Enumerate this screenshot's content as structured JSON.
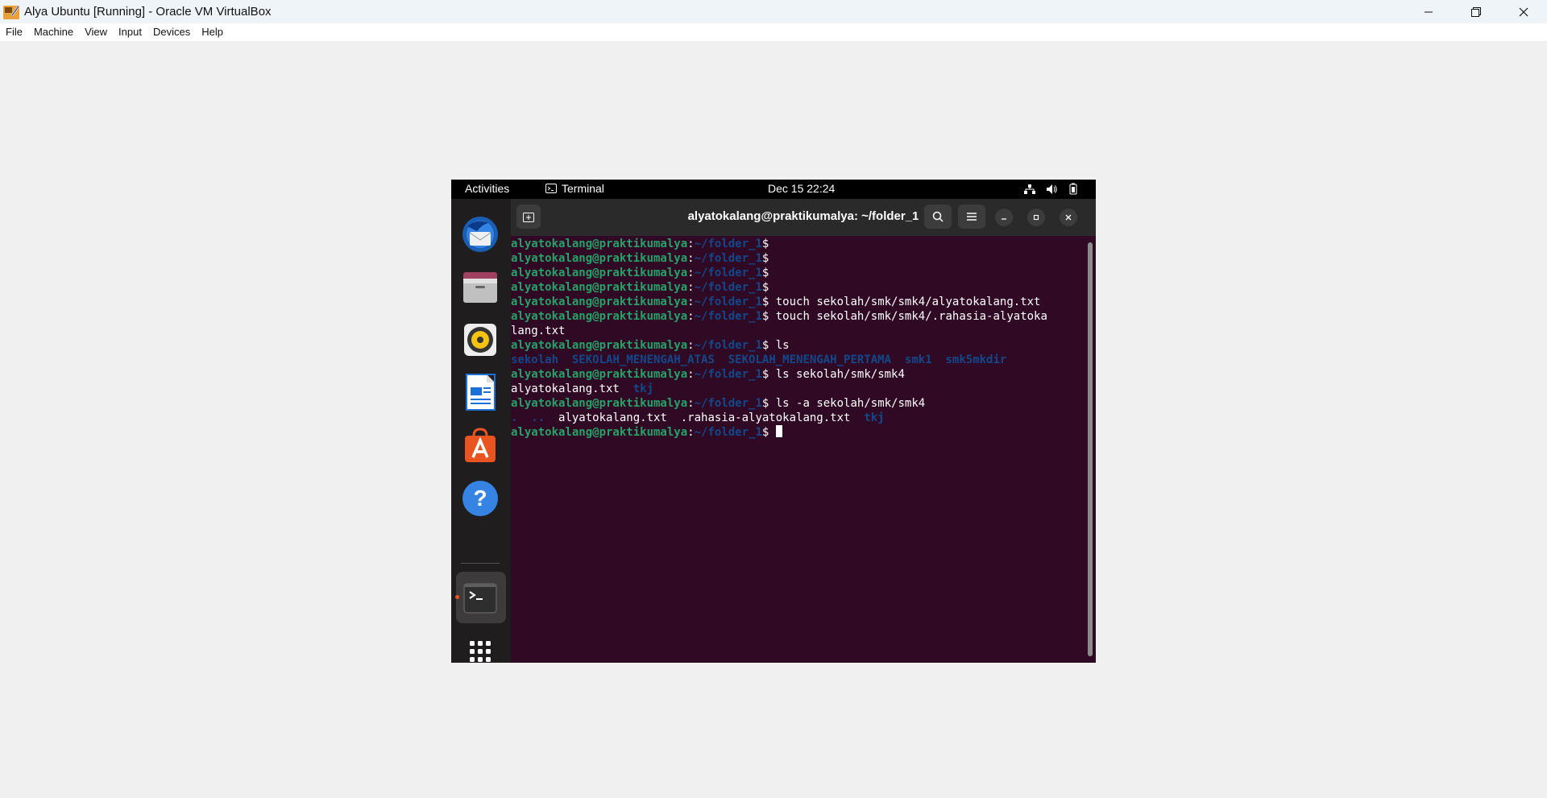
{
  "host": {
    "window_title": "Alya Ubuntu [Running] - Oracle VM VirtualBox",
    "menu": [
      "File",
      "Machine",
      "View",
      "Input",
      "Devices",
      "Help"
    ]
  },
  "guest": {
    "topbar": {
      "activities": "Activities",
      "app_name": "Terminal",
      "clock": "Dec 15  22:24"
    },
    "dock": [
      "thunderbird-mail",
      "files",
      "rhythmbox",
      "libreoffice-writer",
      "ubuntu-software",
      "help",
      "terminal",
      "show-apps"
    ],
    "terminal": {
      "title": "alyatokalang@praktikumalya: ~/folder_1",
      "prompt_user": "alyatokalang@praktikumalya",
      "prompt_path": "~/folder_1",
      "lines": [
        {
          "type": "prompt",
          "cmd": ""
        },
        {
          "type": "prompt",
          "cmd": ""
        },
        {
          "type": "prompt",
          "cmd": ""
        },
        {
          "type": "prompt",
          "cmd": ""
        },
        {
          "type": "prompt",
          "cmd": " touch sekolah/smk/smk4/alyatokalang.txt"
        },
        {
          "type": "prompt",
          "cmd": " touch sekolah/smk/smk4/.rahasia-alyatoka"
        },
        {
          "type": "output",
          "text": "lang.txt"
        },
        {
          "type": "prompt",
          "cmd": " ls"
        },
        {
          "type": "ls",
          "items": [
            {
              "t": "sekolah",
              "dir": true
            },
            {
              "t": "  "
            },
            {
              "t": "SEKOLAH_MENENGAH_ATAS",
              "dir": true
            },
            {
              "t": "  "
            },
            {
              "t": "SEKOLAH_MENENGAH_PERTAMA",
              "dir": true
            },
            {
              "t": "  "
            },
            {
              "t": "smk1",
              "dir": true
            },
            {
              "t": "  "
            },
            {
              "t": "smk5mkdir",
              "dir": true
            }
          ]
        },
        {
          "type": "prompt",
          "cmd": " ls sekolah/smk/smk4"
        },
        {
          "type": "ls",
          "items": [
            {
              "t": "alyatokalang.txt"
            },
            {
              "t": "  "
            },
            {
              "t": "tkj",
              "dir": true
            }
          ]
        },
        {
          "type": "prompt",
          "cmd": " ls -a sekolah/smk/smk4"
        },
        {
          "type": "ls",
          "items": [
            {
              "t": ".",
              "dir": true
            },
            {
              "t": "  "
            },
            {
              "t": "..",
              "dir": true
            },
            {
              "t": "  "
            },
            {
              "t": "alyatokalang.txt"
            },
            {
              "t": "  "
            },
            {
              "t": ".rahasia-alyatokalang.txt"
            },
            {
              "t": "  "
            },
            {
              "t": "tkj",
              "dir": true
            }
          ]
        },
        {
          "type": "prompt",
          "cmd": " ",
          "cursor": true
        }
      ]
    }
  }
}
